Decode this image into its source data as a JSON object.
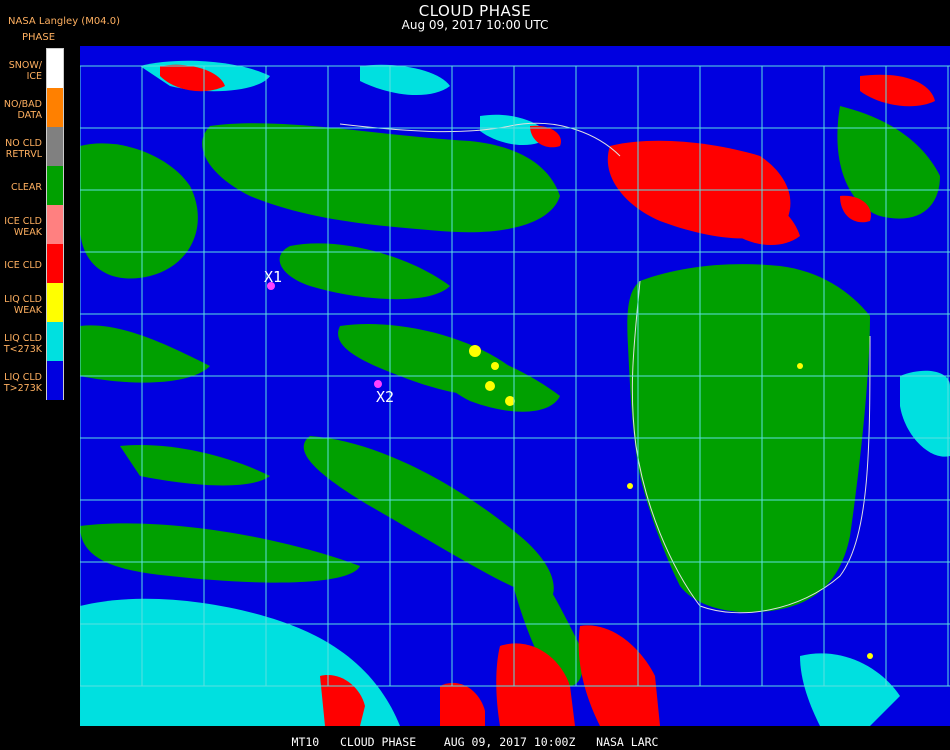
{
  "header": {
    "title": "CLOUD PHASE",
    "subtitle": "Aug 09, 2017 10:00 UTC"
  },
  "org_label": "NASA Langley (M04.0)",
  "legend": {
    "title": "PHASE",
    "items": [
      {
        "label": "SNOW/\nICE",
        "color": "#ffffff"
      },
      {
        "label": "NO/BAD\nDATA",
        "color": "#ff8000"
      },
      {
        "label": "NO CLD\nRETRVL",
        "color": "#808080"
      },
      {
        "label": "CLEAR",
        "color": "#00a000"
      },
      {
        "label": "ICE CLD\nWEAK",
        "color": "#ff8080"
      },
      {
        "label": "ICE CLD",
        "color": "#ff0000"
      },
      {
        "label": "LIQ CLD\nWEAK",
        "color": "#ffff00"
      },
      {
        "label": "LIQ CLD\nT<273K",
        "color": "#00e0e0"
      },
      {
        "label": "LIQ CLD\nT>273K",
        "color": "#0000e0"
      }
    ]
  },
  "markers": [
    {
      "label": "X1"
    },
    {
      "label": "X2"
    }
  ],
  "footer": "MT10   CLOUD PHASE    AUG 09, 2017 10:00Z   NASA LARC",
  "colors": {
    "land_clear": "#00a000",
    "ocean_liquid": "#0000e0",
    "ice": "#ff0000",
    "cold_liquid": "#00e0e0",
    "weak_liquid": "#ffff00",
    "grid": "#5ce0e0",
    "marker": "#ff40ff"
  }
}
